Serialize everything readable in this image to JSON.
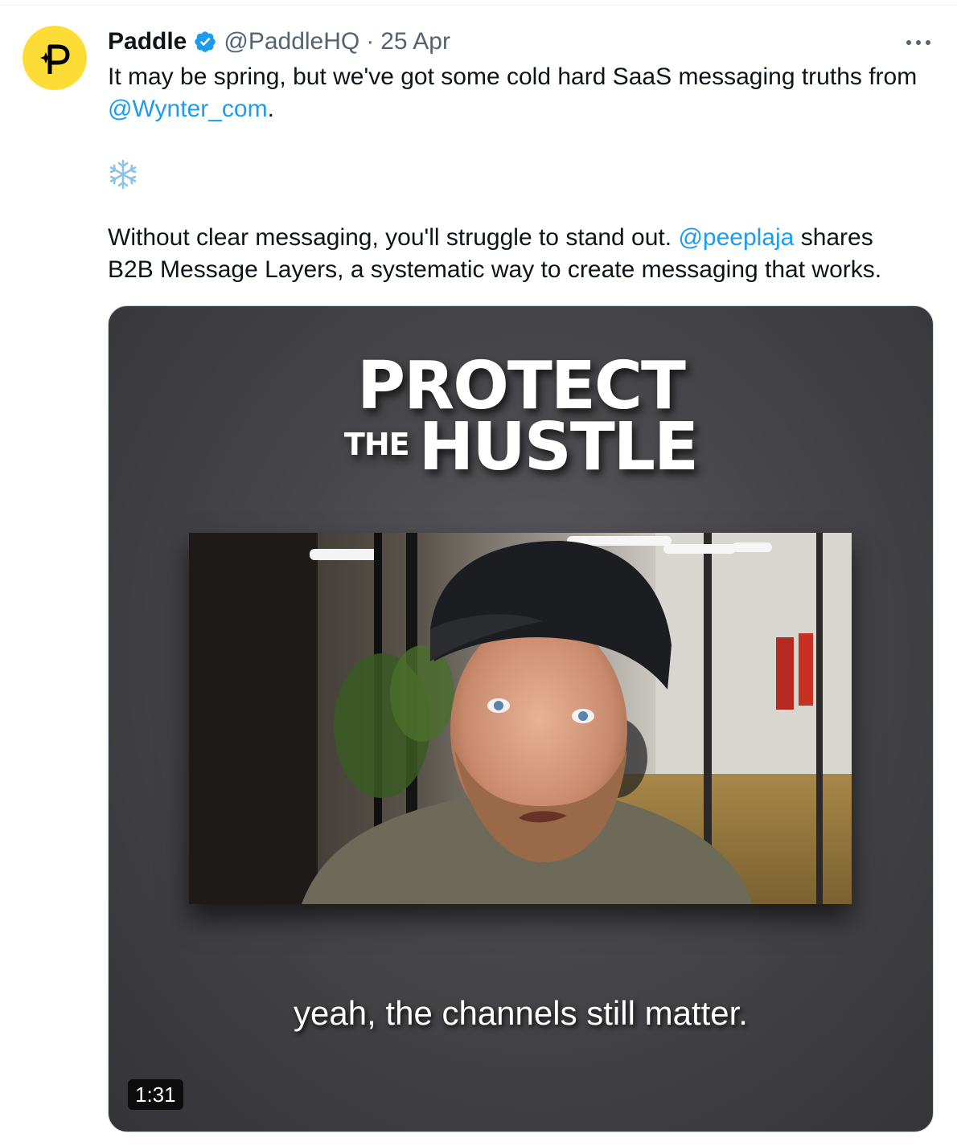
{
  "tweet": {
    "author_name": "Paddle",
    "handle": "@PaddleHQ",
    "separator": "·",
    "date": "25 Apr",
    "line1_text": "It may be spring, but we've got some cold hard SaaS messaging truths from",
    "mention_wynter": "@Wynter_com",
    "line2_suffix": ".",
    "snow_emoji": "❄",
    "para2_start": "Without clear messaging, you'll struggle to stand out.",
    "mention_peep": "@peeplaja",
    "para2_mid": "shares",
    "para2_line2": "B2B Message Layers, a systematic way to create messaging that works."
  },
  "video": {
    "brand_top": "PROTECT",
    "brand_the": "THE",
    "brand_hustle": "HUSTLE",
    "caption": "yeah, the channels still matter.",
    "duration": "1:31"
  },
  "icons": {
    "avatar": "paddle-logo",
    "verified": "verified-badge-icon",
    "more": "more-icon"
  },
  "colors": {
    "link": "#1d9bf0",
    "avatar_bg": "#fddd35",
    "verified": "#1d9bf0"
  }
}
